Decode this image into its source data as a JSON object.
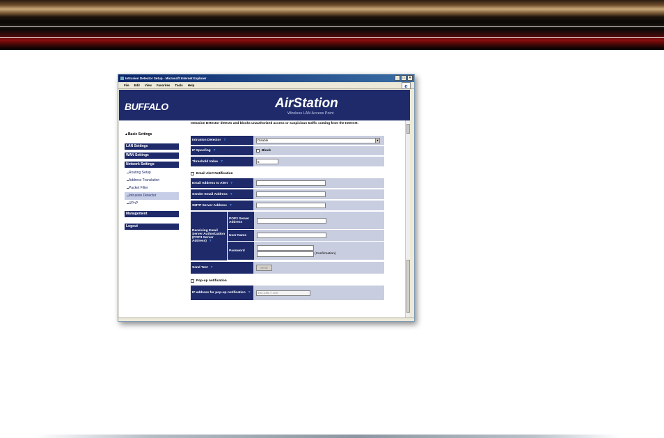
{
  "window": {
    "title": "Intrusion Detector Setup - Microsoft Internet Explorer",
    "min": "_",
    "max": "□",
    "close": "×",
    "ie_logo": "e"
  },
  "menu": [
    "File",
    "Edit",
    "View",
    "Favorites",
    "Tools",
    "Help"
  ],
  "banner": {
    "logo": "BUFFALO",
    "brand": "AirStation",
    "brand_sub": "Wireless LAN Access Point"
  },
  "sidebar": {
    "basic": "▲Basic Settings",
    "lan": "LAN Settings",
    "wan": "WAN Settings",
    "network": "Network Settings",
    "subs": [
      "Routing Setup",
      "Address Translation",
      "Packet Filter",
      "Intrusion Detector",
      "UPnP"
    ],
    "management": "Management",
    "logout": "Logout"
  },
  "main": {
    "intro": "Intrusion Detector detects and blocks unauthorized access or suspicious traffic coming from the Internet.",
    "intrusion_detector_label": "Intrusion Detector",
    "intrusion_detector_value": "Disable",
    "ip_spoofing_label": "IP Spoofing",
    "block_label": "Block",
    "threshold_label": "Threshold Value",
    "threshold_value": "5",
    "email_alert": "Email Alert Notification",
    "email_address_label": "Email Address to Alert",
    "sender_label": "Sender Email Address",
    "smtp_label": "SMTP Server Address",
    "receiving_label": "Receiving Email Server Authorization (POP3 Server Address)",
    "pop3_label": "POP3 Server Address",
    "username_label": "User Name",
    "password_label": "Password",
    "confirmation": "(Confirmation)",
    "send_test_label": "Send Test",
    "send_button": "Send",
    "popup": "Pop-up notification",
    "ip_popup_label": "IP address for pop-up notification",
    "ip_popup_value": "192.168.7.100",
    "help": "?"
  }
}
